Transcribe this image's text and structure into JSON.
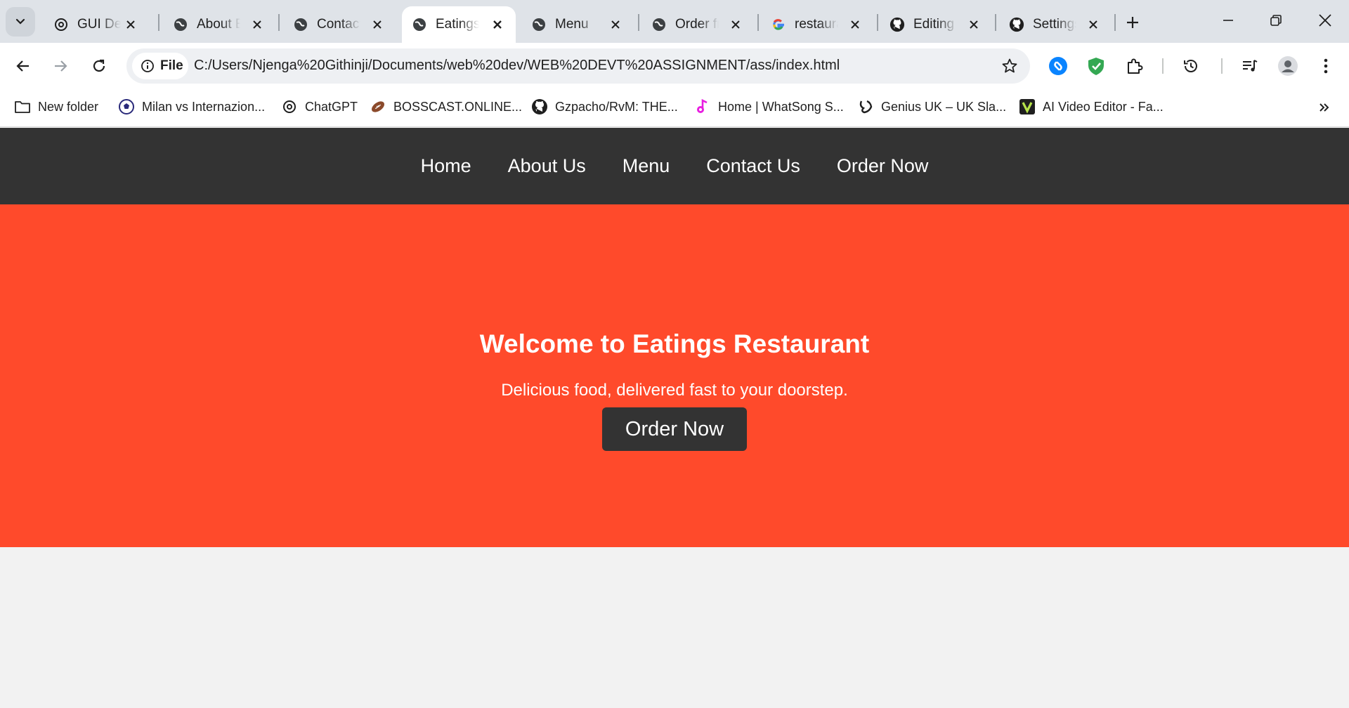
{
  "browser": {
    "tabs": [
      {
        "title": "GUI Design",
        "icon": "openai-icon"
      },
      {
        "title": "About Eatings",
        "icon": "globe-icon"
      },
      {
        "title": "Contact Us",
        "icon": "globe-icon"
      },
      {
        "title": "Eatings Restaurant",
        "icon": "globe-icon",
        "active": true
      },
      {
        "title": "Menu",
        "icon": "globe-icon"
      },
      {
        "title": "Order from Eatings",
        "icon": "globe-icon"
      },
      {
        "title": "restaurant",
        "icon": "google-icon"
      },
      {
        "title": "Editing",
        "icon": "github-icon"
      },
      {
        "title": "Settings",
        "icon": "github-icon"
      }
    ],
    "address": {
      "chip_label": "File",
      "url": "C:/Users/Njenga%20Githinji/Documents/web%20dev/WEB%20DEVT%20ASSIGNMENT/ass/index.html"
    },
    "bookmarks": [
      {
        "label": "New folder",
        "icon": "folder-icon"
      },
      {
        "label": "Milan vs Internazion...",
        "icon": "soccer-ball-icon"
      },
      {
        "label": "ChatGPT",
        "icon": "openai-icon"
      },
      {
        "label": "BOSSCAST.ONLINE...",
        "icon": "football-icon"
      },
      {
        "label": "Gzpacho/RvM: THE...",
        "icon": "github-icon"
      },
      {
        "label": "Home | WhatSong S...",
        "icon": "music-note-icon"
      },
      {
        "label": "Genius UK – UK Sla...",
        "icon": "genius-icon"
      },
      {
        "label": "AI Video Editor - Fa...",
        "icon": "v-logo-icon"
      }
    ]
  },
  "site": {
    "nav": [
      "Home",
      "About Us",
      "Menu",
      "Contact Us",
      "Order Now"
    ],
    "hero": {
      "title": "Welcome to Eatings Restaurant",
      "subtitle": "Delicious food, delivered fast to your doorstep.",
      "button": "Order Now"
    }
  },
  "colors": {
    "nav_bg": "#333333",
    "hero_bg": "#ff4a2b",
    "page_bg": "#f2f2f2"
  }
}
